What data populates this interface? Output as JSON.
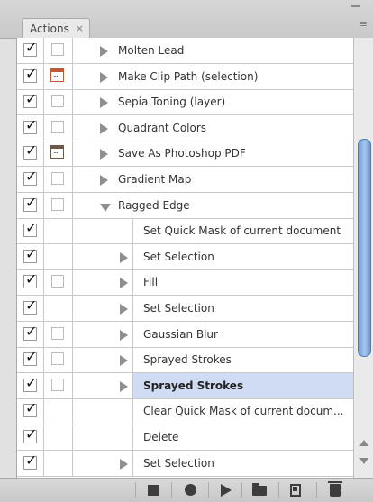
{
  "panel": {
    "tab_title": "Actions",
    "tab_close": "×",
    "menu_glyph": "≡"
  },
  "rows": [
    {
      "label": "Molten Lead",
      "indent": 0,
      "expand": "right",
      "checked": true,
      "dialog": "empty"
    },
    {
      "label": "Make Clip Path (selection)",
      "indent": 0,
      "expand": "right",
      "checked": true,
      "dialog": "icon-red"
    },
    {
      "label": "Sepia Toning (layer)",
      "indent": 0,
      "expand": "right",
      "checked": true,
      "dialog": "empty"
    },
    {
      "label": "Quadrant Colors",
      "indent": 0,
      "expand": "right",
      "checked": true,
      "dialog": "empty"
    },
    {
      "label": "Save As Photoshop PDF",
      "indent": 0,
      "expand": "right",
      "checked": true,
      "dialog": "icon"
    },
    {
      "label": "Gradient Map",
      "indent": 0,
      "expand": "right",
      "checked": true,
      "dialog": "empty"
    },
    {
      "label": "Ragged Edge",
      "indent": 0,
      "expand": "down",
      "checked": true,
      "dialog": "empty"
    },
    {
      "label": "Set Quick Mask of current document",
      "indent": 1,
      "expand": "none",
      "checked": true,
      "dialog": "none"
    },
    {
      "label": "Set Selection",
      "indent": 1,
      "expand": "right",
      "checked": true,
      "dialog": "none"
    },
    {
      "label": "Fill",
      "indent": 1,
      "expand": "right",
      "checked": true,
      "dialog": "empty"
    },
    {
      "label": "Set Selection",
      "indent": 1,
      "expand": "right",
      "checked": true,
      "dialog": "none"
    },
    {
      "label": "Gaussian Blur",
      "indent": 1,
      "expand": "right",
      "checked": true,
      "dialog": "empty"
    },
    {
      "label": "Sprayed Strokes",
      "indent": 1,
      "expand": "right",
      "checked": true,
      "dialog": "empty"
    },
    {
      "label": "Sprayed Strokes",
      "indent": 1,
      "expand": "right",
      "checked": true,
      "dialog": "empty",
      "selected": true
    },
    {
      "label": "Clear Quick Mask of current docum...",
      "indent": 1,
      "expand": "none",
      "checked": true,
      "dialog": "none"
    },
    {
      "label": "Delete",
      "indent": 1,
      "expand": "none",
      "checked": true,
      "dialog": "none"
    },
    {
      "label": "Set Selection",
      "indent": 1,
      "expand": "right",
      "checked": true,
      "dialog": "none"
    }
  ],
  "toolbar": {
    "buttons": [
      "stop-icon",
      "record-icon",
      "play-icon",
      "new-set-icon",
      "new-action-icon",
      "delete-icon"
    ]
  },
  "colors": {
    "selection": "#cfdcf3",
    "scroll_thumb": "#8fb3e6"
  }
}
